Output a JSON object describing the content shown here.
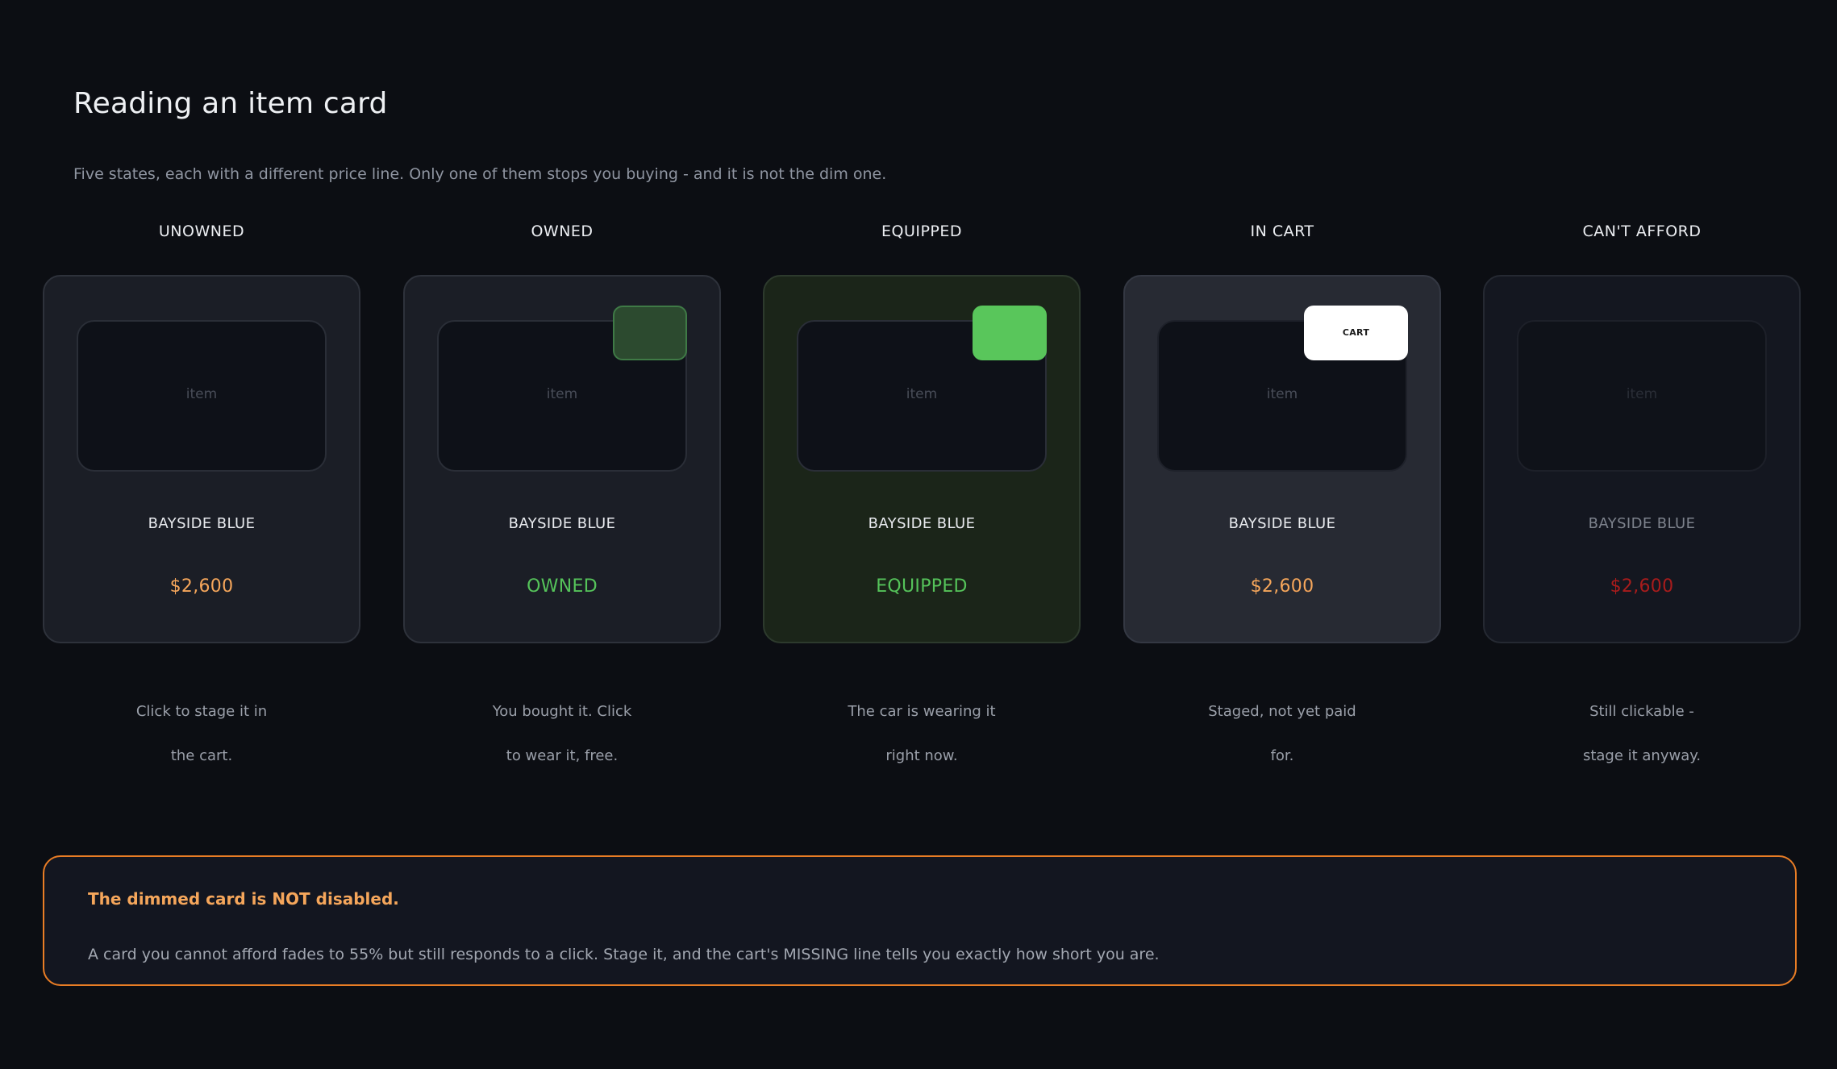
{
  "page": {
    "title": "Reading an item card",
    "subtitle": "Five states, each with a different price line. Only one of them stops you buying - and it is not the dim one."
  },
  "cards": [
    {
      "state": "UNOWNED",
      "thumb": "item",
      "name": "BAYSIDE BLUE",
      "price": "$2,600",
      "desc_line1": "Click to stage it in",
      "desc_line2": "the cart."
    },
    {
      "state": "OWNED",
      "thumb": "item",
      "name": "BAYSIDE BLUE",
      "price": "OWNED",
      "desc_line1": "You bought it. Click",
      "desc_line2": "to wear it, free."
    },
    {
      "state": "EQUIPPED",
      "thumb": "item",
      "name": "BAYSIDE BLUE",
      "price": "EQUIPPED",
      "desc_line1": "The car is wearing it",
      "desc_line2": "right now."
    },
    {
      "state": "IN CART",
      "thumb": "item",
      "badge": "CART",
      "name": "BAYSIDE BLUE",
      "price": "$2,600",
      "desc_line1": "Staged, not yet paid",
      "desc_line2": "for."
    },
    {
      "state": "CAN'T AFFORD",
      "thumb": "item",
      "name": "BAYSIDE BLUE",
      "price": "$2,600",
      "desc_line1": "Still clickable -",
      "desc_line2": "stage it anyway."
    }
  ],
  "note": {
    "title": "The dimmed card is NOT disabled.",
    "body": "A card you cannot afford fades to 55% but still responds to a click. Stage it, and the cart's MISSING line tells you exactly how short you are."
  },
  "colors": {
    "background": "#0c0e13",
    "price_orange": "#f5a65b",
    "price_green": "#55c35a",
    "price_red": "#a81c1c",
    "note_border": "#e97d25"
  }
}
